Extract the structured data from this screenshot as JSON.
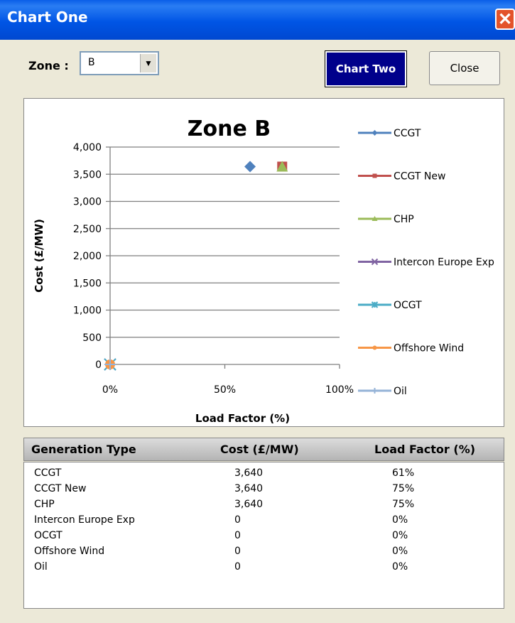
{
  "window": {
    "title": "Chart One",
    "close_glyph": "✕"
  },
  "toolbar": {
    "zone_label": "Zone :",
    "zone_value": "B",
    "chart_two_label": "Chart Two",
    "close_label": "Close"
  },
  "chart_data": {
    "type": "scatter",
    "title": "Zone B",
    "xlabel": "Load Factor (%)",
    "ylabel": "Cost (£/MW)",
    "xlim": [
      0,
      100
    ],
    "ylim": [
      0,
      4000
    ],
    "x_ticks": [
      "0%",
      "50%",
      "100%"
    ],
    "y_ticks": [
      "0",
      "500",
      "1,000",
      "1,500",
      "2,000",
      "2,500",
      "3,000",
      "3,500",
      "4,000"
    ],
    "grid": "horizontal",
    "legend_position": "right",
    "series": [
      {
        "name": "CCGT",
        "color": "#4f81bd",
        "marker": "diamond",
        "points": [
          [
            61,
            3640
          ]
        ]
      },
      {
        "name": "CCGT New",
        "color": "#c0504d",
        "marker": "square",
        "points": [
          [
            75,
            3640
          ]
        ]
      },
      {
        "name": "CHP",
        "color": "#9bbb59",
        "marker": "triangle",
        "points": [
          [
            75,
            3640
          ]
        ]
      },
      {
        "name": "Intercon Europe Exp",
        "color": "#8064a2",
        "marker": "x",
        "points": [
          [
            0,
            0
          ]
        ]
      },
      {
        "name": "OCGT",
        "color": "#4bacc6",
        "marker": "star",
        "points": [
          [
            0,
            0
          ]
        ]
      },
      {
        "name": "Offshore Wind",
        "color": "#f79646",
        "marker": "circle",
        "points": [
          [
            0,
            0
          ]
        ]
      },
      {
        "name": "Oil",
        "color": "#95b3d7",
        "marker": "plus",
        "points": [
          [
            0,
            0
          ]
        ]
      }
    ]
  },
  "table": {
    "headers": [
      "Generation Type",
      "Cost (£/MW)",
      "Load Factor (%)"
    ],
    "rows": [
      [
        "CCGT",
        "3,640",
        "61%"
      ],
      [
        "CCGT New",
        "3,640",
        "75%"
      ],
      [
        "CHP",
        "3,640",
        "75%"
      ],
      [
        "Intercon Europe Exp",
        "0",
        "0%"
      ],
      [
        "OCGT",
        "0",
        "0%"
      ],
      [
        "Offshore Wind",
        "0",
        "0%"
      ],
      [
        "Oil",
        "0",
        "0%"
      ]
    ]
  }
}
